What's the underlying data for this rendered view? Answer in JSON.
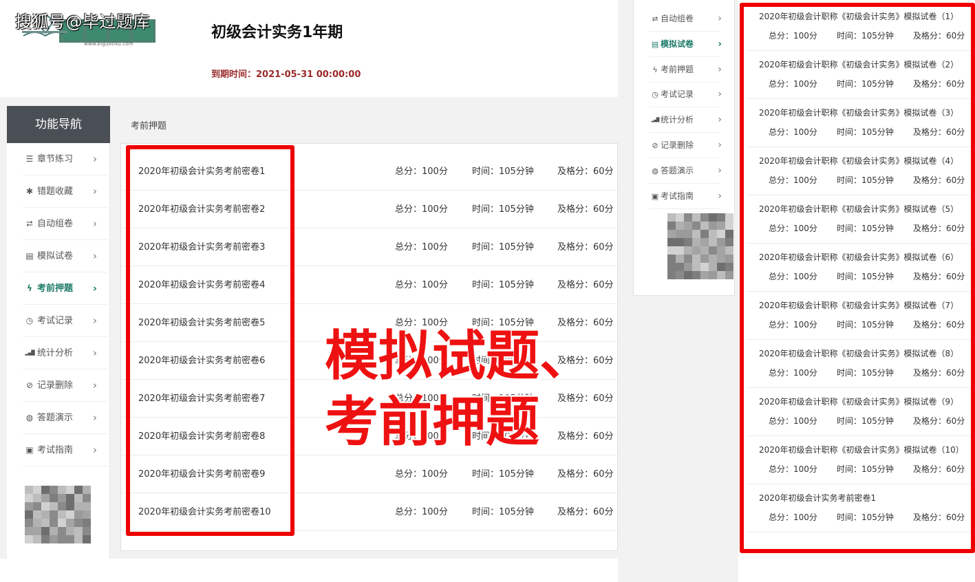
{
  "watermark": "搜狐号@毕过题库",
  "logo": {
    "subtext": "www.biguotiku.com"
  },
  "header": {
    "course_title": "初级会计实务1年期",
    "expire_label": "到期时间：",
    "expire_value": "2021-05-31 00:00:00"
  },
  "sidebar": {
    "title": "功能导航",
    "items": [
      {
        "label": "章节练习",
        "icon": "list-icon"
      },
      {
        "label": "错题收藏",
        "icon": "asterisk-icon"
      },
      {
        "label": "自动组卷",
        "icon": "loop-icon"
      },
      {
        "label": "模拟试卷",
        "icon": "doc-icon"
      },
      {
        "label": "考前押题",
        "icon": "bolt-icon",
        "active": true
      },
      {
        "label": "考试记录",
        "icon": "clock-icon"
      },
      {
        "label": "统计分析",
        "icon": "bar-chart-icon"
      },
      {
        "label": "记录删除",
        "icon": "ban-icon"
      },
      {
        "label": "答题演示",
        "icon": "globe-icon"
      },
      {
        "label": "考试指南",
        "icon": "print-icon"
      }
    ]
  },
  "content": {
    "tab": "考前押题",
    "papers": [
      {
        "title": "2020年初级会计实务考前密卷1",
        "score": "总分：100分",
        "time": "时间：105分钟",
        "pass": "及格分：60分"
      },
      {
        "title": "2020年初级会计实务考前密卷2",
        "score": "总分：100分",
        "time": "时间：105分钟",
        "pass": "及格分：60分"
      },
      {
        "title": "2020年初级会计实务考前密卷3",
        "score": "总分：100分",
        "time": "时间：105分钟",
        "pass": "及格分：60分"
      },
      {
        "title": "2020年初级会计实务考前密卷4",
        "score": "总分：100分",
        "time": "时间：105分钟",
        "pass": "及格分：60分"
      },
      {
        "title": "2020年初级会计实务考前密卷5",
        "score": "总分：100分",
        "time": "时间：105分钟",
        "pass": "及格分：60分"
      },
      {
        "title": "2020年初级会计实务考前密卷6",
        "score": "总分：100分",
        "time": "时间：105分钟",
        "pass": "及格分：60分"
      },
      {
        "title": "2020年初级会计实务考前密卷7",
        "score": "总分：100分",
        "time": "时间：105分钟",
        "pass": "及格分：60分"
      },
      {
        "title": "2020年初级会计实务考前密卷8",
        "score": "总分：100分",
        "time": "时间：105分钟",
        "pass": "及格分：60分"
      },
      {
        "title": "2020年初级会计实务考前密卷9",
        "score": "总分：100分",
        "time": "时间：105分钟",
        "pass": "及格分：60分"
      },
      {
        "title": "2020年初级会计实务考前密卷10",
        "score": "总分：100分",
        "time": "时间：105分钟",
        "pass": "及格分：60分"
      }
    ]
  },
  "overlay": {
    "line1": "模拟试题、",
    "line2": "考前押题"
  },
  "mid_nav": {
    "items": [
      {
        "label": "自动组卷",
        "icon": "loop-icon"
      },
      {
        "label": "模拟试卷",
        "icon": "doc-icon",
        "active": true
      },
      {
        "label": "考前押题",
        "icon": "bolt-icon"
      },
      {
        "label": "考试记录",
        "icon": "clock-icon"
      },
      {
        "label": "统计分析",
        "icon": "bar-chart-icon"
      },
      {
        "label": "记录删除",
        "icon": "ban-icon"
      },
      {
        "label": "答题演示",
        "icon": "globe-icon"
      },
      {
        "label": "考试指南",
        "icon": "print-icon"
      }
    ]
  },
  "mock_list": [
    {
      "title": "2020年初级会计职称《初级会计实务》模拟试卷（1）",
      "score": "总分：100分",
      "time": "时间：105分钟",
      "pass": "及格分：60分"
    },
    {
      "title": "2020年初级会计职称《初级会计实务》模拟试卷（2）",
      "score": "总分：100分",
      "time": "时间：105分钟",
      "pass": "及格分：60分"
    },
    {
      "title": "2020年初级会计职称《初级会计实务》模拟试卷（3）",
      "score": "总分：100分",
      "time": "时间：105分钟",
      "pass": "及格分：60分"
    },
    {
      "title": "2020年初级会计职称《初级会计实务》模拟试卷（4）",
      "score": "总分：100分",
      "time": "时间：105分钟",
      "pass": "及格分：60分"
    },
    {
      "title": "2020年初级会计职称《初级会计实务》模拟试卷（5）",
      "score": "总分：100分",
      "time": "时间：105分钟",
      "pass": "及格分：60分"
    },
    {
      "title": "2020年初级会计职称《初级会计实务》模拟试卷（6）",
      "score": "总分：100分",
      "time": "时间：105分钟",
      "pass": "及格分：60分"
    },
    {
      "title": "2020年初级会计职称《初级会计实务》模拟试卷（7）",
      "score": "总分：100分",
      "time": "时间：105分钟",
      "pass": "及格分：60分"
    },
    {
      "title": "2020年初级会计职称《初级会计实务》模拟试卷（8）",
      "score": "总分：100分",
      "time": "时间：105分钟",
      "pass": "及格分：60分"
    },
    {
      "title": "2020年初级会计职称《初级会计实务》模拟试卷（9）",
      "score": "总分：100分",
      "time": "时间：105分钟",
      "pass": "及格分：60分"
    },
    {
      "title": "2020年初级会计职称《初级会计实务》模拟试卷（10）",
      "score": "总分：100分",
      "time": "时间：105分钟",
      "pass": "及格分：60分"
    },
    {
      "title": "2020年初级会计实务考前密卷1",
      "score": "总分：100分",
      "time": "时间：105分钟",
      "pass": "及格分：60分"
    }
  ],
  "colors": {
    "accent": "#1e7b6a",
    "frame": "#ee0000",
    "nav_header": "#4a4f55",
    "expire": "#9a2a2a"
  }
}
